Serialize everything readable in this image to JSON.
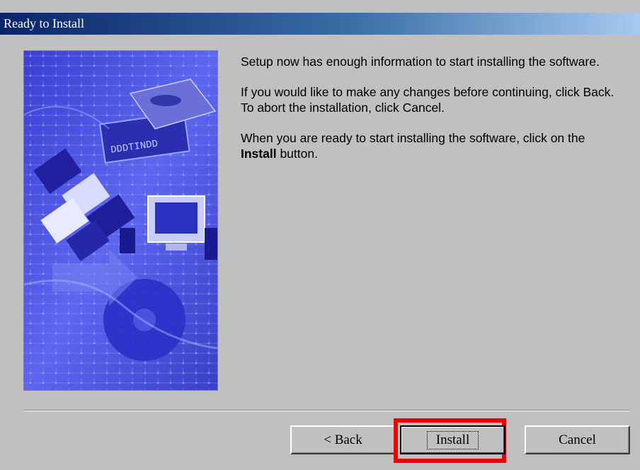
{
  "window": {
    "title": "Ready to Install"
  },
  "body": {
    "paragraph1": "Setup now has enough information to start installing the software.",
    "paragraph2": "If you would like to make any changes before continuing, click Back.  To abort the installation, click Cancel.",
    "paragraph3_before": "When you are ready to start installing the software, click on the ",
    "paragraph3_bold": "Install",
    "paragraph3_after": " button."
  },
  "buttons": {
    "back_label": "< Back",
    "install_label": "Install",
    "cancel_label": "Cancel"
  },
  "colors": {
    "titlebar_start": "#0a246a",
    "titlebar_end": "#a6caf0",
    "dialog_bg": "#c0c0c0",
    "highlight_box": "#ee0000"
  }
}
